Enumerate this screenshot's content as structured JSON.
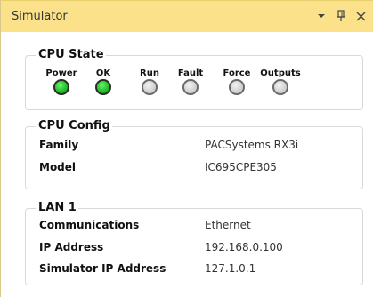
{
  "window": {
    "title": "Simulator",
    "dropdown_icon": "chevron-down-icon",
    "pin_icon": "pin-icon",
    "close_icon": "close-icon"
  },
  "cpu_state": {
    "legend": "CPU State",
    "leds": [
      {
        "label": "Power",
        "state": "on"
      },
      {
        "label": "OK",
        "state": "on"
      },
      {
        "label": "Run",
        "state": "off"
      },
      {
        "label": "Fault",
        "state": "off"
      },
      {
        "label": "Force",
        "state": "off"
      },
      {
        "label": "Outputs",
        "state": "off"
      }
    ],
    "colors": {
      "on": "#21c22a",
      "off": "#d2d2d2"
    }
  },
  "cpu_config": {
    "legend": "CPU Config",
    "rows": [
      {
        "label": "Family",
        "value": "PACSystems RX3i"
      },
      {
        "label": "Model",
        "value": "IC695CPE305"
      }
    ]
  },
  "lan1": {
    "legend": "LAN 1",
    "rows": [
      {
        "label": "Communications",
        "value": "Ethernet"
      },
      {
        "label": "IP Address",
        "value": "192.168.0.100"
      },
      {
        "label": "Simulator IP Address",
        "value": "127.1.0.1"
      }
    ]
  },
  "colors": {
    "titlebar": "#fbe28a",
    "led_on": "#21c22a",
    "led_off": "#d2d2d2"
  }
}
